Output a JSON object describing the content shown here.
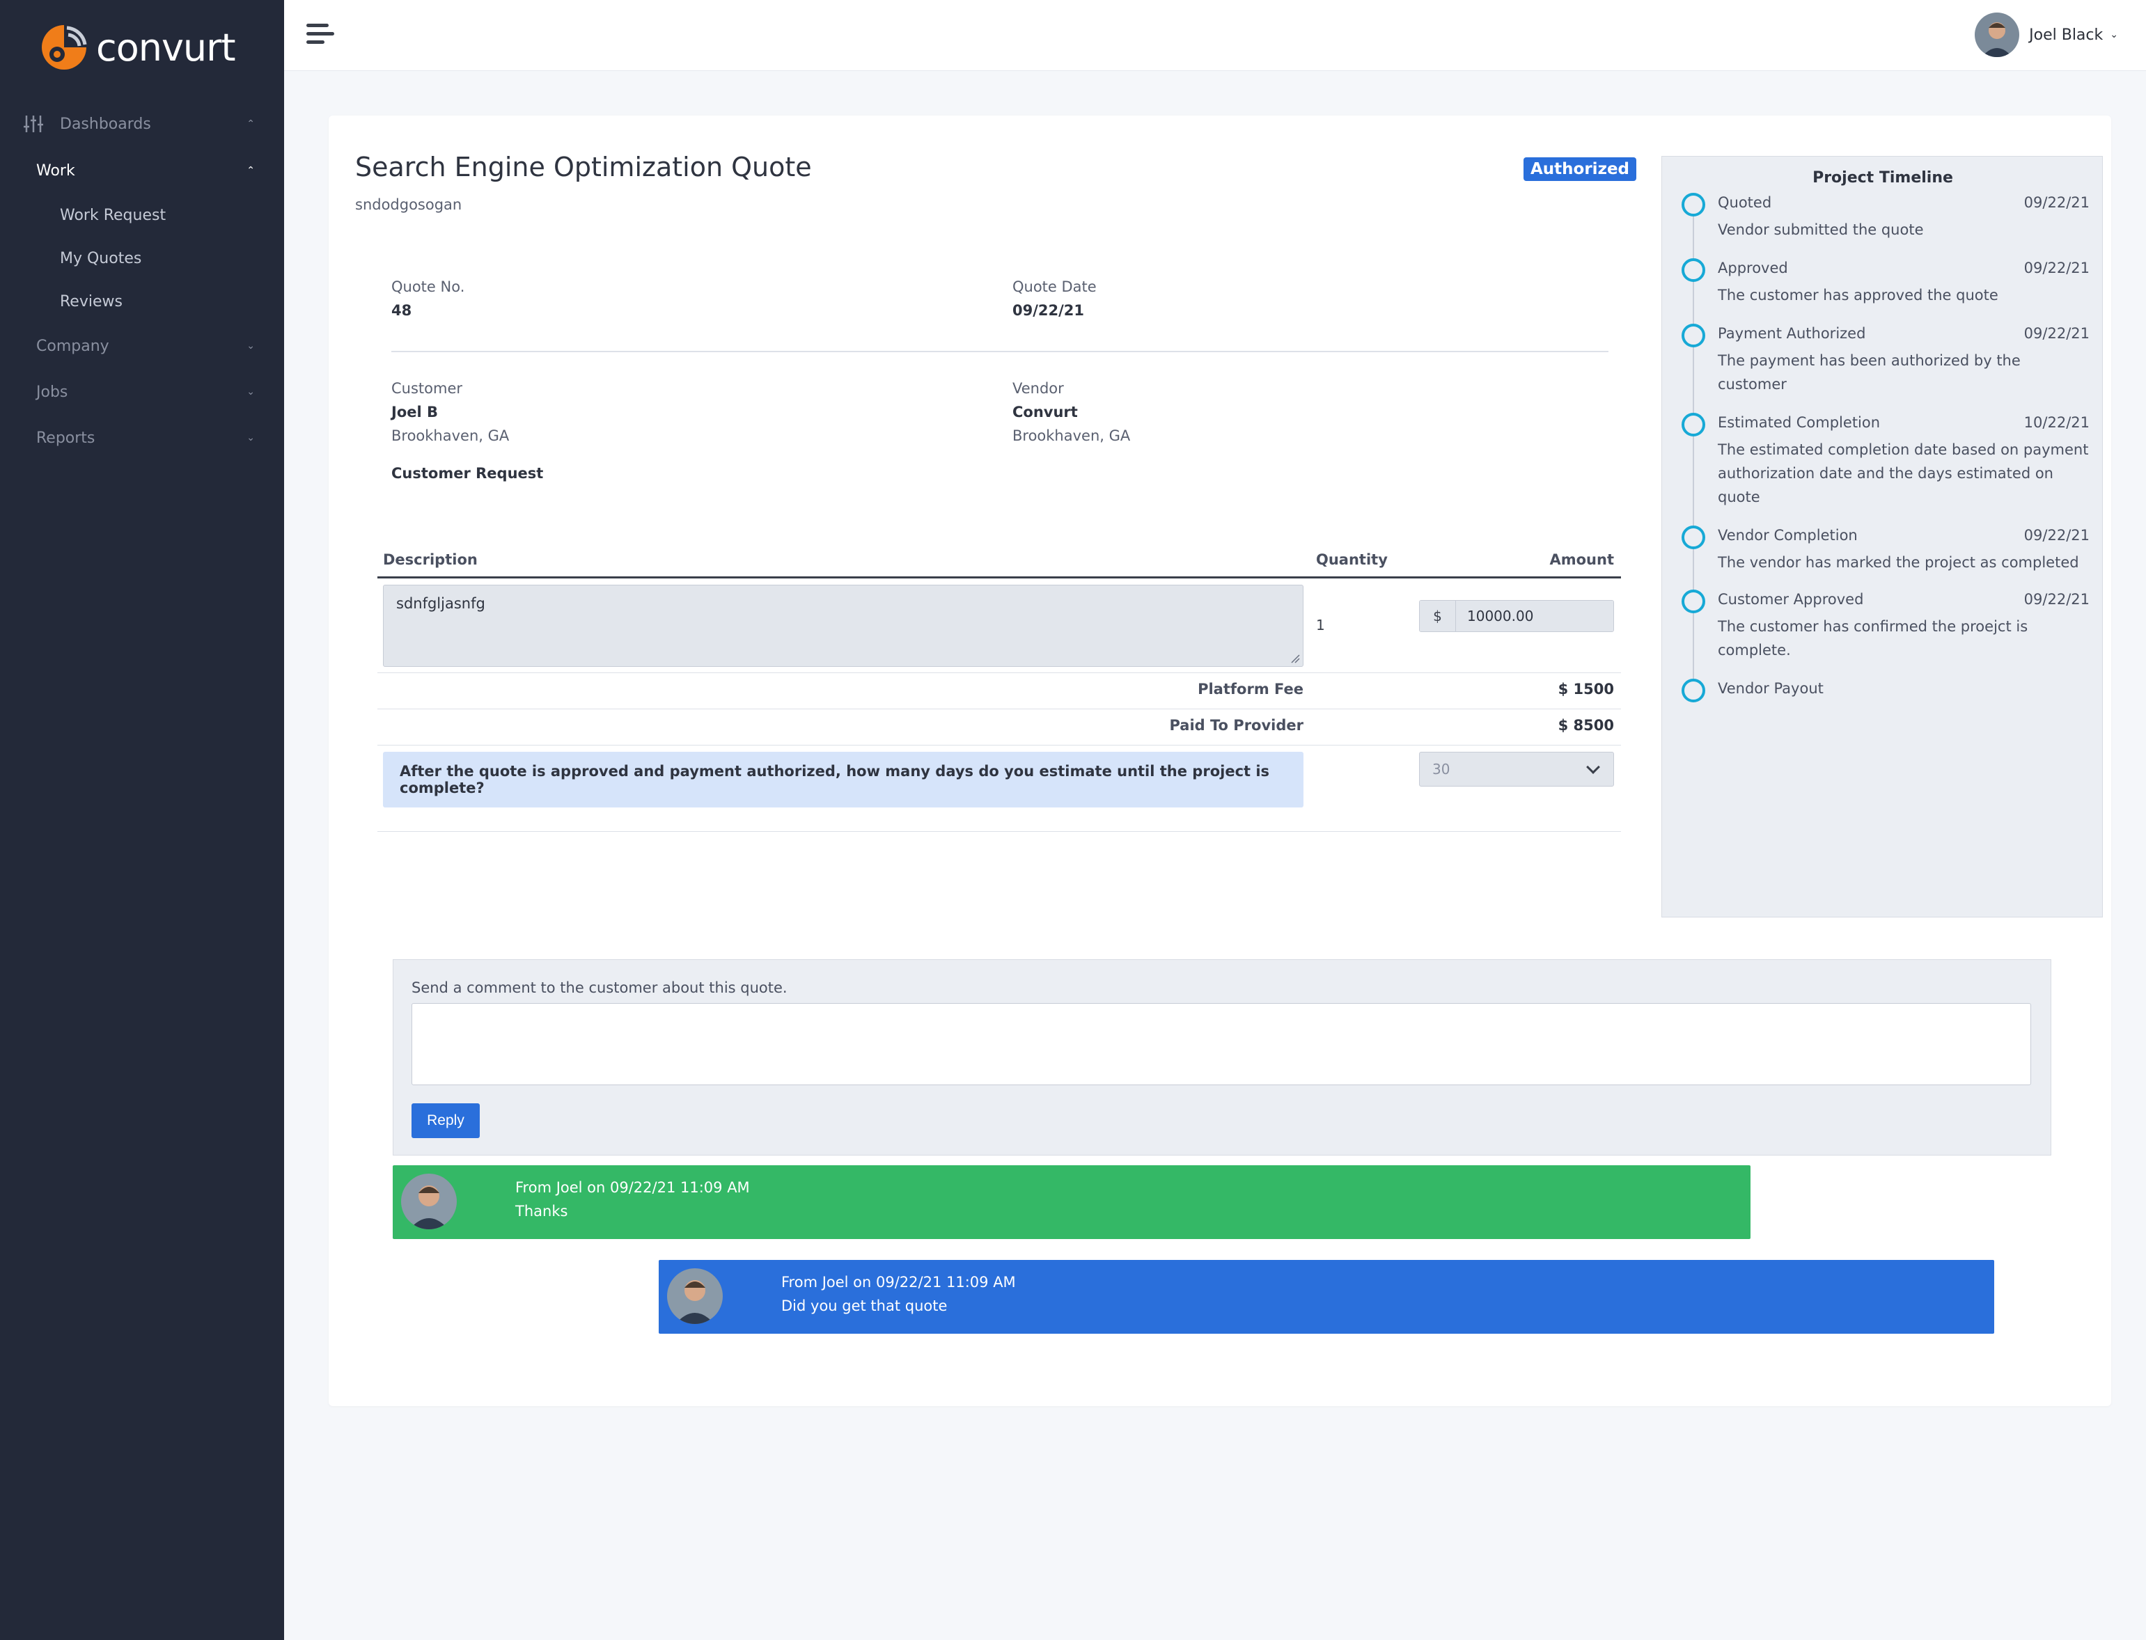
{
  "app": {
    "name": "convurt"
  },
  "sidebar": {
    "items": [
      {
        "label": "Dashboards",
        "state": "expanded"
      },
      {
        "label": "Work",
        "state": "expanded",
        "active": true,
        "children": [
          {
            "label": "Work Request"
          },
          {
            "label": "My Quotes"
          },
          {
            "label": "Reviews"
          }
        ]
      },
      {
        "label": "Company"
      },
      {
        "label": "Jobs"
      },
      {
        "label": "Reports"
      }
    ]
  },
  "header": {
    "user_name": "Joel Black"
  },
  "quote": {
    "title": "Search Engine Optimization Quote",
    "subtitle": "sndodgosogan",
    "status": "Authorized",
    "quote_no_label": "Quote No.",
    "quote_no": "48",
    "quote_date_label": "Quote Date",
    "quote_date": "09/22/21",
    "customer_label": "Customer",
    "customer_name": "Joel B",
    "customer_location": "Brookhaven, GA",
    "vendor_label": "Vendor",
    "vendor_name": "Convurt",
    "vendor_location": "Brookhaven, GA",
    "customer_request_label": "Customer Request"
  },
  "line_items": {
    "headers": {
      "description": "Description",
      "quantity": "Quantity",
      "amount": "Amount"
    },
    "description": "sdnfgljasnfg",
    "quantity": "1",
    "currency_symbol": "$",
    "amount": "10000.00",
    "platform_fee_label": "Platform Fee",
    "platform_fee": "$ 1500",
    "paid_to_provider_label": "Paid To Provider",
    "paid_to_provider": "$ 8500",
    "estimate_question": "After the quote is approved and payment authorized, how many days do you estimate until the project is complete?",
    "estimate_days": "30"
  },
  "timeline": {
    "title": "Project Timeline",
    "events": [
      {
        "name": "Quoted",
        "date": "09/22/21",
        "description": "Vendor submitted the quote"
      },
      {
        "name": "Approved",
        "date": "09/22/21",
        "description": "The customer has approved the quote"
      },
      {
        "name": "Payment Authorized",
        "date": "09/22/21",
        "description": "The payment has been authorized by the customer"
      },
      {
        "name": "Estimated Completion",
        "date": "10/22/21",
        "description": "The estimated completion date based on payment authorization date and the days estimated on quote"
      },
      {
        "name": "Vendor Completion",
        "date": "09/22/21",
        "description": "The vendor has marked the project as completed"
      },
      {
        "name": "Customer Approved",
        "date": "09/22/21",
        "description": "The customer has confirmed the proejct is complete."
      },
      {
        "name": "Vendor Payout",
        "date": "",
        "description": ""
      }
    ]
  },
  "comments": {
    "prompt": "Send a comment to the customer about this quote.",
    "input_value": "",
    "reply_label": "Reply",
    "messages": [
      {
        "header": "From Joel on 09/22/21 11:09 AM",
        "body": "Thanks",
        "color": "#34b866"
      },
      {
        "header": "From Joel on 09/22/21 11:09 AM",
        "body": "Did you get that quote",
        "color": "#2a6fdb"
      }
    ]
  },
  "colors": {
    "accent": "#2a6fdb",
    "brand_orange": "#f07d19",
    "sidebar_bg": "#232939",
    "timeline_dot": "#17a9d6",
    "success": "#34b866"
  },
  "icons": [
    "logo-icon",
    "dashboards-icon",
    "chevron-up-icon",
    "chevron-down-icon",
    "hamburger-icon",
    "avatar",
    "resize-handle-icon"
  ]
}
